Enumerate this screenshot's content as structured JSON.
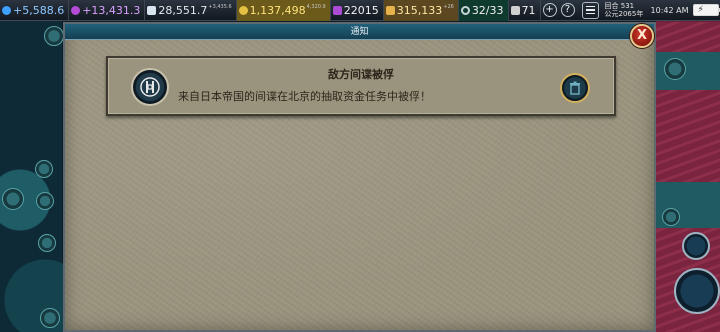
{
  "top_bar": {
    "science": "+5,588.6",
    "culture": "+13,431.3",
    "faith": "28,551.7",
    "faith_rate": "+3,435.6",
    "gold": "1,137,498",
    "gold_rate": "4,320.9",
    "tourism": "22015",
    "favor": "315,133",
    "favor_rate": "+26",
    "trade_routes": "32/33",
    "governors": "71",
    "turn": "回合 531",
    "year": "公元2065年",
    "time": "10:42 AM"
  },
  "notification_window": {
    "title": "通知",
    "close_icon": "close-x-icon",
    "card": {
      "icon": "spy-icon",
      "heading": "敌方间谍被俘",
      "message": "来自日本帝国的间谍在北京的抽取资金任务中被俘！",
      "action_icon": "dismiss-icon"
    }
  },
  "colors": {
    "panel": "#9b957f",
    "header": "#1b516a",
    "close": "#b52a1f",
    "action_ring": "#d3b15c"
  }
}
